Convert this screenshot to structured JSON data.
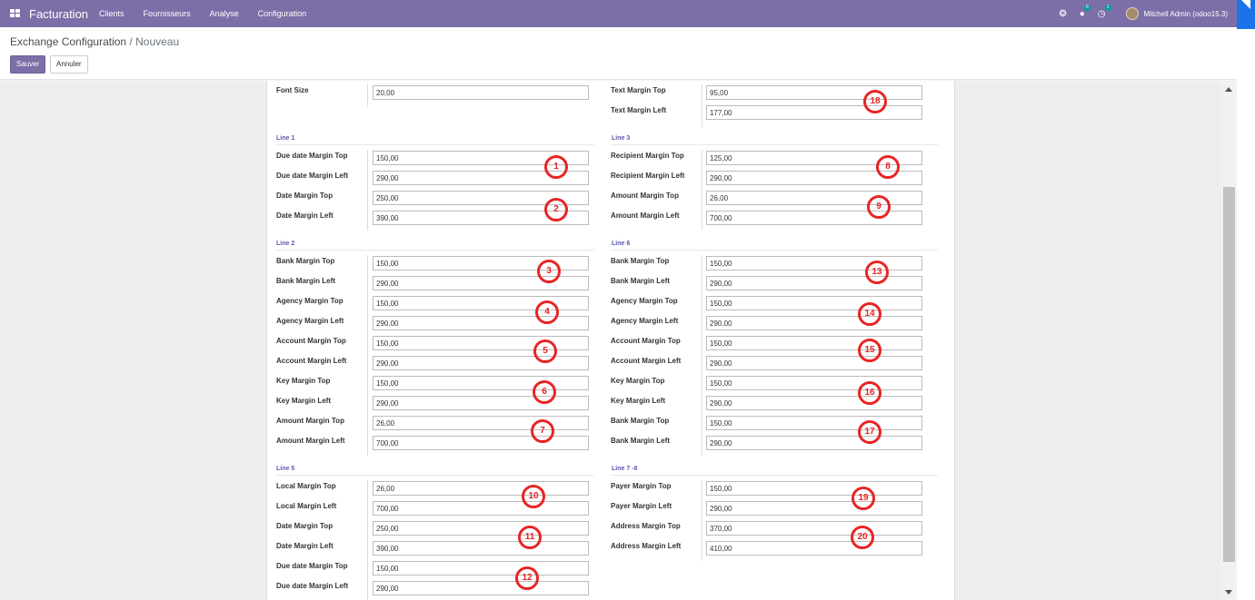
{
  "navbar": {
    "brand": "Facturation",
    "menu": [
      "Clients",
      "Fournisseurs",
      "Analyse",
      "Configuration"
    ],
    "chat_badge": "6",
    "activity_badge": "1",
    "user": "Mitchell Admin (odoo15.3)"
  },
  "breadcrumb": {
    "parent": "Exchange Configuration",
    "sep": " / ",
    "current": "Nouveau"
  },
  "buttons": {
    "save": "Sauver",
    "discard": "Annuler"
  },
  "form": {
    "font_size_label": "Font Size",
    "font_size_value": "20,00",
    "text_margin_top_label": "Text Margin Top",
    "text_margin_top_value": "95,00",
    "text_margin_left_label": "Text Margin Left",
    "text_margin_left_value": "177,00",
    "line1": {
      "title": "Line 1",
      "fields": [
        {
          "label": "Due date Margin Top",
          "value": "150,00"
        },
        {
          "label": "Due date Margin Left",
          "value": "290,00"
        },
        {
          "label": "Date Margin Top",
          "value": "250,00"
        },
        {
          "label": "Date Margin Left",
          "value": "390,00"
        }
      ]
    },
    "line3": {
      "title": "Line 3",
      "fields": [
        {
          "label": "Recipient Margin Top",
          "value": "125,00"
        },
        {
          "label": "Recipient Margin Left",
          "value": "290,00"
        },
        {
          "label": "Amount Margin Top",
          "value": "26,00"
        },
        {
          "label": "Amount Margin Left",
          "value": "700,00"
        }
      ]
    },
    "line2": {
      "title": "Line 2",
      "fields": [
        {
          "label": "Bank Margin Top",
          "value": "150,00"
        },
        {
          "label": "Bank Margin Left",
          "value": "290,00"
        },
        {
          "label": "Agency Margin Top",
          "value": "150,00"
        },
        {
          "label": "Agency Margin Left",
          "value": "290,00"
        },
        {
          "label": "Account Margin Top",
          "value": "150,00"
        },
        {
          "label": "Account Margin Left",
          "value": "290,00"
        },
        {
          "label": "Key Margin Top",
          "value": "150,00"
        },
        {
          "label": "Key Margin Left",
          "value": "290,00"
        },
        {
          "label": "Amount Margin Top",
          "value": "26,00"
        },
        {
          "label": "Amount Margin Left",
          "value": "700,00"
        }
      ]
    },
    "line6": {
      "title": "Line 6",
      "fields": [
        {
          "label": "Bank Margin Top",
          "value": "150,00"
        },
        {
          "label": "Bank Margin Left",
          "value": "290,00"
        },
        {
          "label": "Agency Margin Top",
          "value": "150,00"
        },
        {
          "label": "Agency Margin Left",
          "value": "290,00"
        },
        {
          "label": "Account Margin Top",
          "value": "150,00"
        },
        {
          "label": "Account Margin Left",
          "value": "290,00"
        },
        {
          "label": "Key Margin Top",
          "value": "150,00"
        },
        {
          "label": "Key Margin Left",
          "value": "290,00"
        },
        {
          "label": "Bank Margin Top",
          "value": "150,00"
        },
        {
          "label": "Bank Margin Left",
          "value": "290,00"
        }
      ]
    },
    "line5": {
      "title": "Line 5",
      "fields": [
        {
          "label": "Local Margin Top",
          "value": "26,00"
        },
        {
          "label": "Local Margin Left",
          "value": "700,00"
        },
        {
          "label": "Date Margin Top",
          "value": "250,00"
        },
        {
          "label": "Date Margin Left",
          "value": "390,00"
        },
        {
          "label": "Due date Margin Top",
          "value": "150,00"
        },
        {
          "label": "Due date Margin Left",
          "value": "290,00"
        }
      ]
    },
    "line78": {
      "title": "Line 7 -8",
      "fields": [
        {
          "label": "Payer Margin Top",
          "value": "150,00"
        },
        {
          "label": "Payer Margin Left",
          "value": "290,00"
        },
        {
          "label": "Address Margin Top",
          "value": "370,00"
        },
        {
          "label": "Address Margin Left",
          "value": "410,00"
        }
      ]
    }
  },
  "annotations": [
    "1",
    "2",
    "3",
    "4",
    "5",
    "6",
    "7",
    "8",
    "9",
    "10",
    "11",
    "12",
    "13",
    "14",
    "15",
    "16",
    "17",
    "18",
    "19",
    "20"
  ],
  "colors": {
    "navbar": "#7c6fa8",
    "primary_button": "#7c6fa8",
    "annotation": "#e82424",
    "group_title": "#5c5aa8"
  }
}
